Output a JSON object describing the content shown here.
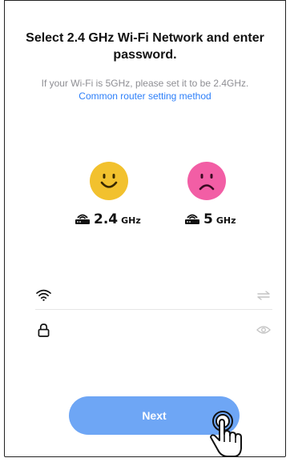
{
  "header": {
    "title": "Select 2.4 GHz Wi-Fi Network and enter password."
  },
  "notice": {
    "text": "If your Wi-Fi is 5GHz, please set it to be 2.4GHz.",
    "link": "Common router setting method"
  },
  "bands": [
    {
      "number": "2.4",
      "unit": "GHz",
      "face": "happy",
      "face_color": "#f2c12e"
    },
    {
      "number": "5",
      "unit": "GHz",
      "face": "sad",
      "face_color": "#f25ea5"
    }
  ],
  "form": {
    "wifi": {
      "icon": "wifi-icon",
      "value": "",
      "placeholder": "",
      "action_icon": "swap-icon"
    },
    "password": {
      "icon": "lock-icon",
      "value": "",
      "placeholder": "",
      "action_icon": "eye-icon"
    }
  },
  "actions": {
    "next_label": "Next"
  },
  "colors": {
    "accent": "#2d7ff9",
    "button": "#6ea6f5"
  }
}
